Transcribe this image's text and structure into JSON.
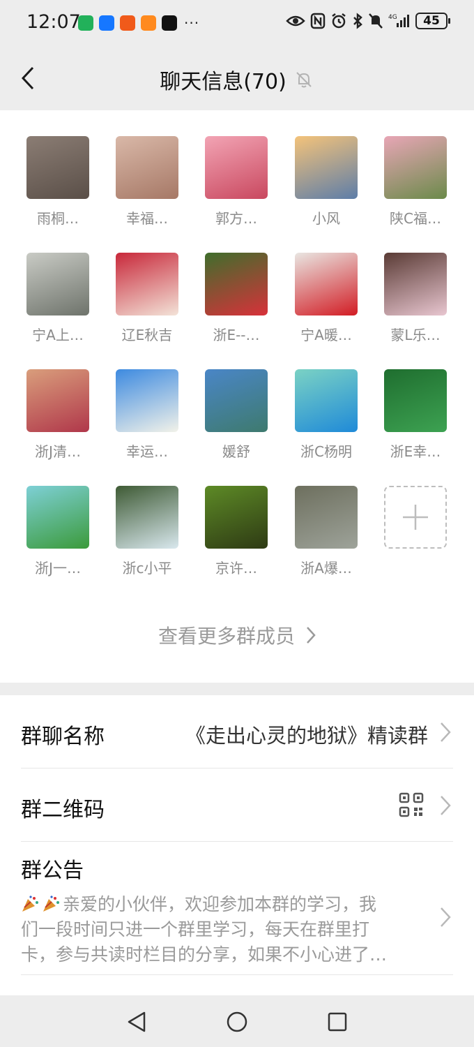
{
  "status_bar": {
    "time": "12:07",
    "apps": [
      {
        "icon": "green-app-icon",
        "color": "#22b15a"
      },
      {
        "icon": "alipay-icon",
        "color": "#1677ff"
      },
      {
        "icon": "taobao-icon",
        "color": "#f05a1a"
      },
      {
        "icon": "orange-app-icon",
        "color": "#ff8a1e"
      },
      {
        "icon": "tiktok-icon",
        "color": "#111111"
      }
    ],
    "more_dots": "···",
    "battery": "45"
  },
  "header": {
    "title": "聊天信息(70)",
    "mute": true
  },
  "members": [
    {
      "name": "雨桐…",
      "color1": "#8b7d74",
      "color2": "#5a4f48"
    },
    {
      "name": "幸福…",
      "color1": "#d9b8a8",
      "color2": "#a67866"
    },
    {
      "name": "郭方…",
      "color1": "#f2a4b4",
      "color2": "#c9485f"
    },
    {
      "name": "小风",
      "color1": "#f4c37a",
      "color2": "#5d7da8"
    },
    {
      "name": "陕C福…",
      "color1": "#e8a6b6",
      "color2": "#6b8a4a"
    },
    {
      "name": "宁A上…",
      "color1": "#c9cbc5",
      "color2": "#6e736b"
    },
    {
      "name": "辽E秋吉",
      "color1": "#c8283a",
      "color2": "#f3e3d8"
    },
    {
      "name": "浙E--…",
      "color1": "#3f6e2c",
      "color2": "#d8313a"
    },
    {
      "name": "宁A暖…",
      "color1": "#e9e6e2",
      "color2": "#d21c24"
    },
    {
      "name": "蒙L乐…",
      "color1": "#5a3b35",
      "color2": "#e8c6d0"
    },
    {
      "name": "浙J清…",
      "color1": "#d99e7c",
      "color2": "#b0374a"
    },
    {
      "name": "幸运…",
      "color1": "#3d8ae0",
      "color2": "#f2f2e9"
    },
    {
      "name": "媛舒",
      "color1": "#4a86c7",
      "color2": "#3e7a6e"
    },
    {
      "name": "浙C杨明",
      "color1": "#7bd2c4",
      "color2": "#1f8ad8"
    },
    {
      "name": "浙E幸…",
      "color1": "#1f6e2f",
      "color2": "#3da252"
    },
    {
      "name": "浙J一…",
      "color1": "#7ed0d6",
      "color2": "#3b9a3a"
    },
    {
      "name": "浙c小平",
      "color1": "#3e5a34",
      "color2": "#d9e8ee"
    },
    {
      "name": "京许…",
      "color1": "#5d8a26",
      "color2": "#2e3a14"
    },
    {
      "name": "浙A爆…",
      "color1": "#6d6f5e",
      "color2": "#9ea39a"
    }
  ],
  "add_member_icon": "plus-icon",
  "more_members": {
    "label": "查看更多群成员"
  },
  "settings": {
    "group_name": {
      "label": "群聊名称",
      "value": "《走出心灵的地狱》精读群"
    },
    "qr_code": {
      "label": "群二维码",
      "icon": "qr-code-icon"
    },
    "notice": {
      "label": "群公告",
      "line1": "亲爱的小伙伴，欢迎参加本群的学习，我",
      "line2": "们一段时间只进一个群里学习，每天在群里打",
      "line3": "卡，参与共读时栏目的分享，如果不小心进了…"
    }
  },
  "system_nav": {
    "back": "triangle-back-icon",
    "home": "circle-home-icon",
    "recents": "square-recents-icon"
  }
}
